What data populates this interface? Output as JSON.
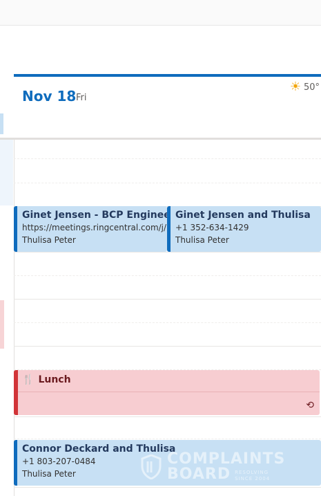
{
  "header": {
    "date": "Nov 18",
    "weekday": "Fri",
    "weather_icon": "sun-icon",
    "temperature": "50°"
  },
  "events": [
    {
      "title": "Ginet Jensen - BCP Engineer",
      "detail": "https://meetings.ringcentral.com/j/",
      "organizer": "Thulisa Peter"
    },
    {
      "title": "Ginet Jensen and Thulisa",
      "detail": "+1 352-634-1429",
      "organizer": "Thulisa Peter"
    },
    {
      "title": "Connor Deckard and Thulisa",
      "detail": "+1 803-207-0484",
      "organizer": "Thulisa Peter"
    }
  ],
  "lunch": {
    "icon": "fork-knife-icon",
    "title": "Lunch",
    "status_icon": "sync-off-icon"
  },
  "watermark": {
    "line1": "COMPLAINTS",
    "line2": "BOARD",
    "sub1": "RESOLVING",
    "sub2": "SINCE 2004"
  },
  "colors": {
    "accent": "#0f6cbd",
    "event_blue": "#c7e0f4",
    "lunch_red": "#d13438",
    "lunch_bg": "#f7cdd1"
  }
}
